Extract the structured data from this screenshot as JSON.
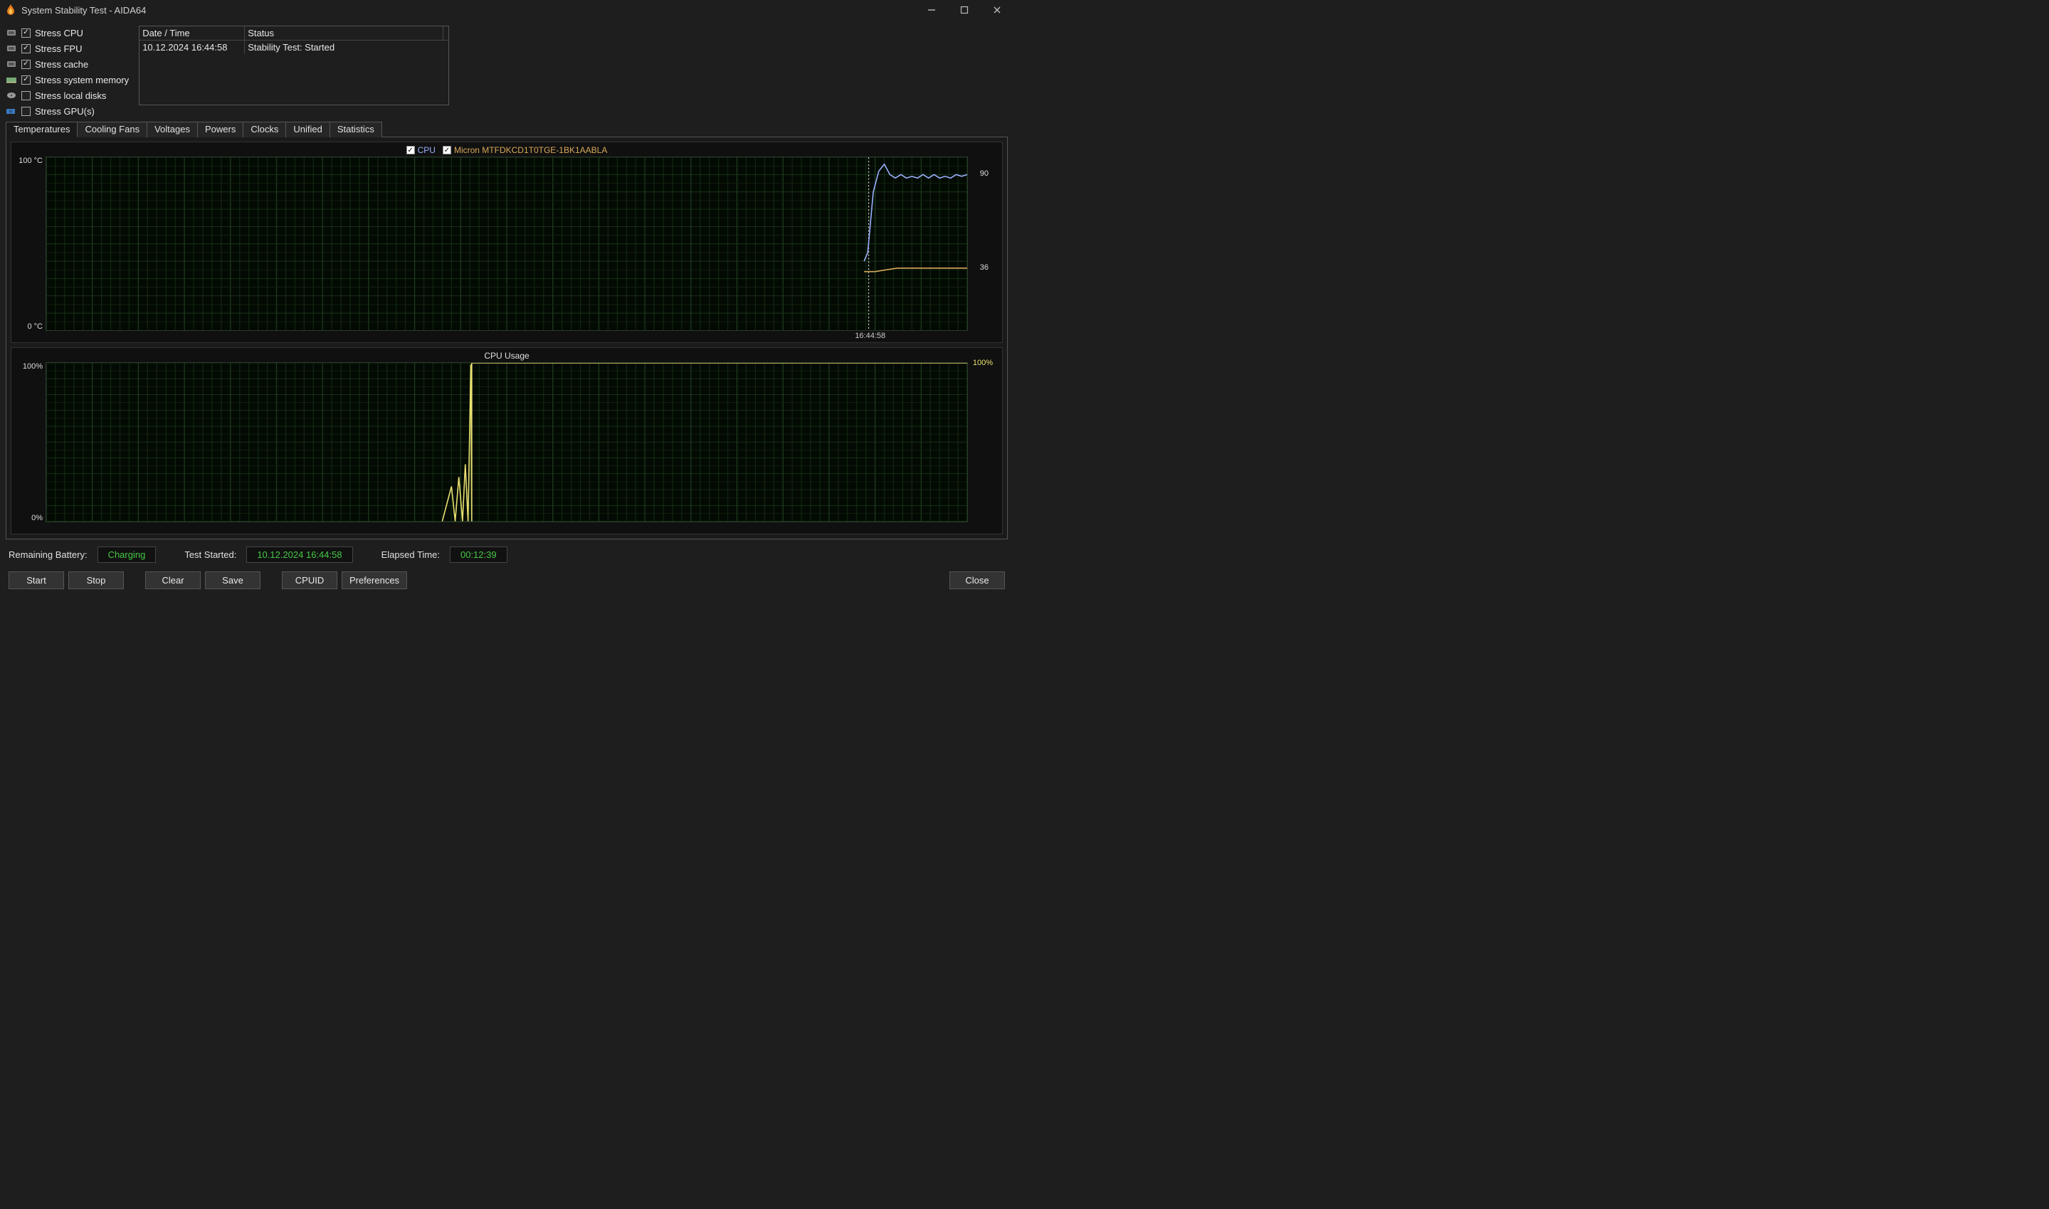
{
  "window": {
    "title": "System Stability Test - AIDA64"
  },
  "stress": {
    "items": [
      {
        "label": "Stress CPU",
        "checked": true,
        "icon": "chip"
      },
      {
        "label": "Stress FPU",
        "checked": true,
        "icon": "chip"
      },
      {
        "label": "Stress cache",
        "checked": true,
        "icon": "chip"
      },
      {
        "label": "Stress system memory",
        "checked": true,
        "icon": "ram"
      },
      {
        "label": "Stress local disks",
        "checked": false,
        "icon": "disk"
      },
      {
        "label": "Stress GPU(s)",
        "checked": false,
        "icon": "gpu"
      }
    ]
  },
  "log": {
    "head": {
      "c1": "Date / Time",
      "c2": "Status"
    },
    "rows": [
      {
        "c1": "10.12.2024 16:44:58",
        "c2": "Stability Test: Started"
      }
    ]
  },
  "tabs": {
    "items": [
      "Temperatures",
      "Cooling Fans",
      "Voltages",
      "Powers",
      "Clocks",
      "Unified",
      "Statistics"
    ],
    "active": 0
  },
  "chart_data": [
    {
      "type": "line",
      "title": "",
      "ylabel": "°C",
      "ylim": [
        0,
        100
      ],
      "y_top_label": "100 °C",
      "y_bot_label": "0 °C",
      "x_marker": "16:44:58",
      "x_marker_frac": 0.893,
      "series": [
        {
          "name": "CPU",
          "color": "#9bb0ff",
          "current": 90,
          "points_frac": [
            [
              0.888,
              0.6
            ],
            [
              0.892,
              0.55
            ],
            [
              0.898,
              0.2
            ],
            [
              0.904,
              0.08
            ],
            [
              0.91,
              0.04
            ],
            [
              0.916,
              0.1
            ],
            [
              0.922,
              0.12
            ],
            [
              0.928,
              0.1
            ],
            [
              0.934,
              0.12
            ],
            [
              0.94,
              0.11
            ],
            [
              0.946,
              0.12
            ],
            [
              0.952,
              0.1
            ],
            [
              0.958,
              0.12
            ],
            [
              0.964,
              0.1
            ],
            [
              0.97,
              0.12
            ],
            [
              0.976,
              0.11
            ],
            [
              0.982,
              0.12
            ],
            [
              0.988,
              0.1
            ],
            [
              0.994,
              0.11
            ],
            [
              1.0,
              0.1
            ]
          ]
        },
        {
          "name": "Micron MTFDKCD1T0TGE-1BK1AABLA",
          "color": "#d9a85a",
          "current": 36,
          "points_frac": [
            [
              0.888,
              0.66
            ],
            [
              0.9,
              0.66
            ],
            [
              0.912,
              0.65
            ],
            [
              0.924,
              0.64
            ],
            [
              1.0,
              0.64
            ]
          ]
        }
      ]
    },
    {
      "type": "line",
      "title": "CPU Usage",
      "ylabel": "%",
      "ylim": [
        0,
        100
      ],
      "y_top_label": "100%",
      "y_bot_label": "0%",
      "right_label": "100%",
      "series": [
        {
          "name": "CPU Usage",
          "color": "#e8e070",
          "points_frac": [
            [
              0.43,
              1.0
            ],
            [
              0.44,
              0.78
            ],
            [
              0.444,
              1.0
            ],
            [
              0.448,
              0.72
            ],
            [
              0.452,
              1.0
            ],
            [
              0.455,
              0.64
            ],
            [
              0.458,
              1.0
            ],
            [
              0.461,
              0.01
            ],
            [
              0.462,
              1.0
            ],
            [
              0.462,
              0.0
            ],
            [
              0.466,
              0.0
            ],
            [
              1.0,
              0.0
            ]
          ]
        }
      ]
    }
  ],
  "status": {
    "battery_lbl": "Remaining Battery:",
    "battery_val": "Charging",
    "started_lbl": "Test Started:",
    "started_val": "10.12.2024 16:44:58",
    "elapsed_lbl": "Elapsed Time:",
    "elapsed_val": "00:12:39"
  },
  "buttons": {
    "start": "Start",
    "stop": "Stop",
    "clear": "Clear",
    "save": "Save",
    "cpuid": "CPUID",
    "prefs": "Preferences",
    "close": "Close"
  }
}
